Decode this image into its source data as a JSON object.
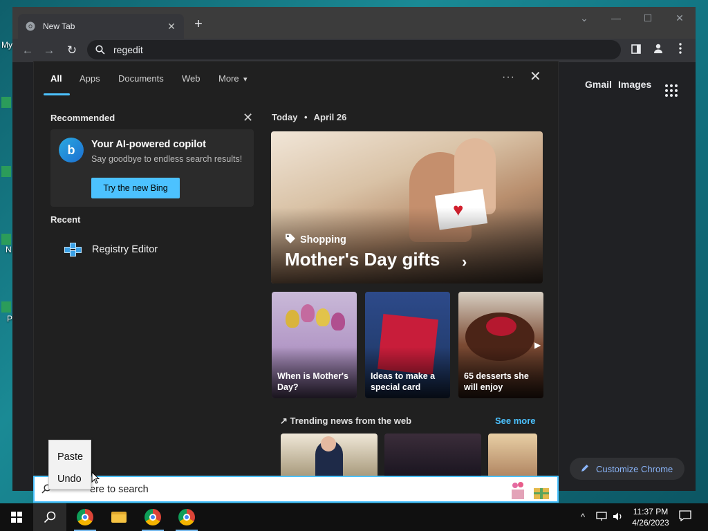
{
  "desktop": {
    "labels": [
      "My",
      "N",
      "P"
    ]
  },
  "browser": {
    "tab_title": "New Tab",
    "tab_close": "✕",
    "new_tab": "+",
    "controls": {
      "minimize": "—",
      "restore": "☐",
      "close": "✕",
      "dropdown": "⌄"
    },
    "nav": {
      "back": "←",
      "forward": "→",
      "reload": "↻"
    },
    "address_value": "regedit",
    "search_icon": "search-icon"
  },
  "ntp": {
    "gmail": "Gmail",
    "images": "Images",
    "customize": "Customize Chrome"
  },
  "search_panel": {
    "filters": [
      "All",
      "Apps",
      "Documents",
      "Web",
      "More"
    ],
    "more_caret": "▾",
    "overflow": "···",
    "close": "✕",
    "recommended": {
      "heading": "Recommended",
      "dismiss": "✕",
      "card_title": "Your AI-powered copilot",
      "card_subtitle": "Say goodbye to endless search results!",
      "button": "Try the new Bing",
      "logo_letter": "b"
    },
    "recent": {
      "heading": "Recent",
      "items": [
        {
          "label": "Registry Editor",
          "icon": "registry-editor-icon"
        }
      ]
    },
    "today": {
      "label": "Today",
      "separator": "•",
      "date": "April 26"
    },
    "hero": {
      "tag": "Shopping",
      "headline": "Mother's Day gifts",
      "chevron": "›"
    },
    "cards": [
      {
        "caption": "When is Mother's Day?"
      },
      {
        "caption": "Ideas to make a special card"
      },
      {
        "caption": "65 desserts she will enjoy"
      }
    ],
    "trending": {
      "heading": "↗ Trending news from the web",
      "see_more": "See more"
    }
  },
  "searchbox": {
    "placeholder": "ere to search"
  },
  "context_menu": {
    "items": [
      "Paste",
      "Undo"
    ]
  },
  "taskbar": {
    "time": "11:37 PM",
    "date": "4/26/2023",
    "tray_chevron": "^",
    "notification": "☐"
  },
  "colors": {
    "accent": "#4cc2ff",
    "panel_bg": "#202020",
    "chrome_bg": "#202124"
  }
}
